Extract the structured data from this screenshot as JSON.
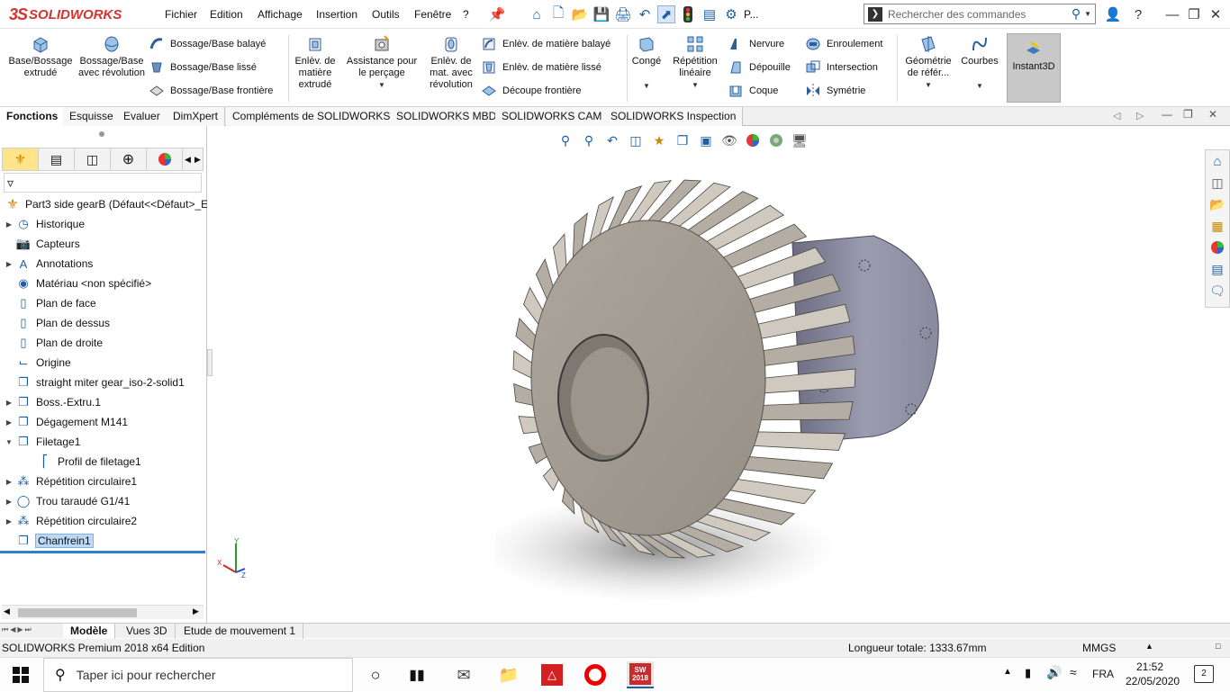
{
  "app": {
    "logo_ds": "3S",
    "logo_text": "SOLIDWORKS",
    "menu": [
      "Fichier",
      "Edition",
      "Affichage",
      "Insertion",
      "Outils",
      "Fenêtre",
      "?"
    ],
    "quick_p": "P...",
    "search_placeholder": "Rechercher des commandes"
  },
  "ribbon": {
    "big_buttons": [
      "Base/Bossage extrudé",
      "Bossage/Base avec révolution",
      "Enlèv. de matière extrudé",
      "Assistance pour le perçage",
      "Enlèv. de mat. avec révolution",
      "Congé",
      "Répétition linéaire",
      "Géométrie de référ...",
      "Courbes",
      "Instant3D"
    ],
    "small_col1": [
      "Bossage/Base balayé",
      "Bossage/Base lissé",
      "Bossage/Base frontière"
    ],
    "small_col2": [
      "Enlèv. de matière balayé",
      "Enlèv. de matière lissé",
      "Découpe frontière"
    ],
    "small_col3": [
      "Nervure",
      "Dépouille",
      "Coque"
    ],
    "small_col4": [
      "Enroulement",
      "Intersection",
      "Symétrie"
    ]
  },
  "tabs": [
    "Fonctions",
    "Esquisse",
    "Evaluer",
    "DimXpert",
    "Compléments de SOLIDWORKS",
    "SOLIDWORKS MBD",
    "SOLIDWORKS CAM",
    "SOLIDWORKS Inspection"
  ],
  "tree": {
    "root": "Part3 side gearB  (Défaut<<Défaut>_E",
    "items": [
      "Historique",
      "Capteurs",
      "Annotations",
      "Matériau <non spécifié>",
      "Plan de face",
      "Plan de dessus",
      "Plan de droite",
      "Origine",
      "straight miter gear_iso-2-solid1",
      "Boss.-Extru.1",
      "Dégagement M141",
      "Filetage1",
      "Profil de filetage1",
      "Répétition circulaire1",
      "Trou taraudé G1/41",
      "Répétition circulaire2",
      "Chanfrein1"
    ]
  },
  "triad": {
    "x": "X",
    "y": "Y",
    "z": "Z"
  },
  "bottom_tabs": [
    "Modèle",
    "Vues 3D",
    "Etude de mouvement 1"
  ],
  "status": {
    "edition": "SOLIDWORKS Premium 2018 x64 Edition",
    "length": "Longueur totale: 1333.67mm",
    "units": "MMGS"
  },
  "taskbar": {
    "search_placeholder": "Taper ici pour rechercher",
    "lang": "FRA",
    "time": "21:52",
    "date": "22/05/2020",
    "notifications": "2",
    "sw_badge": "2018"
  },
  "colors": {
    "accent": "#d6322e",
    "selection": "#bcd9f7",
    "instant3d_bg": "#c8c8c8"
  }
}
